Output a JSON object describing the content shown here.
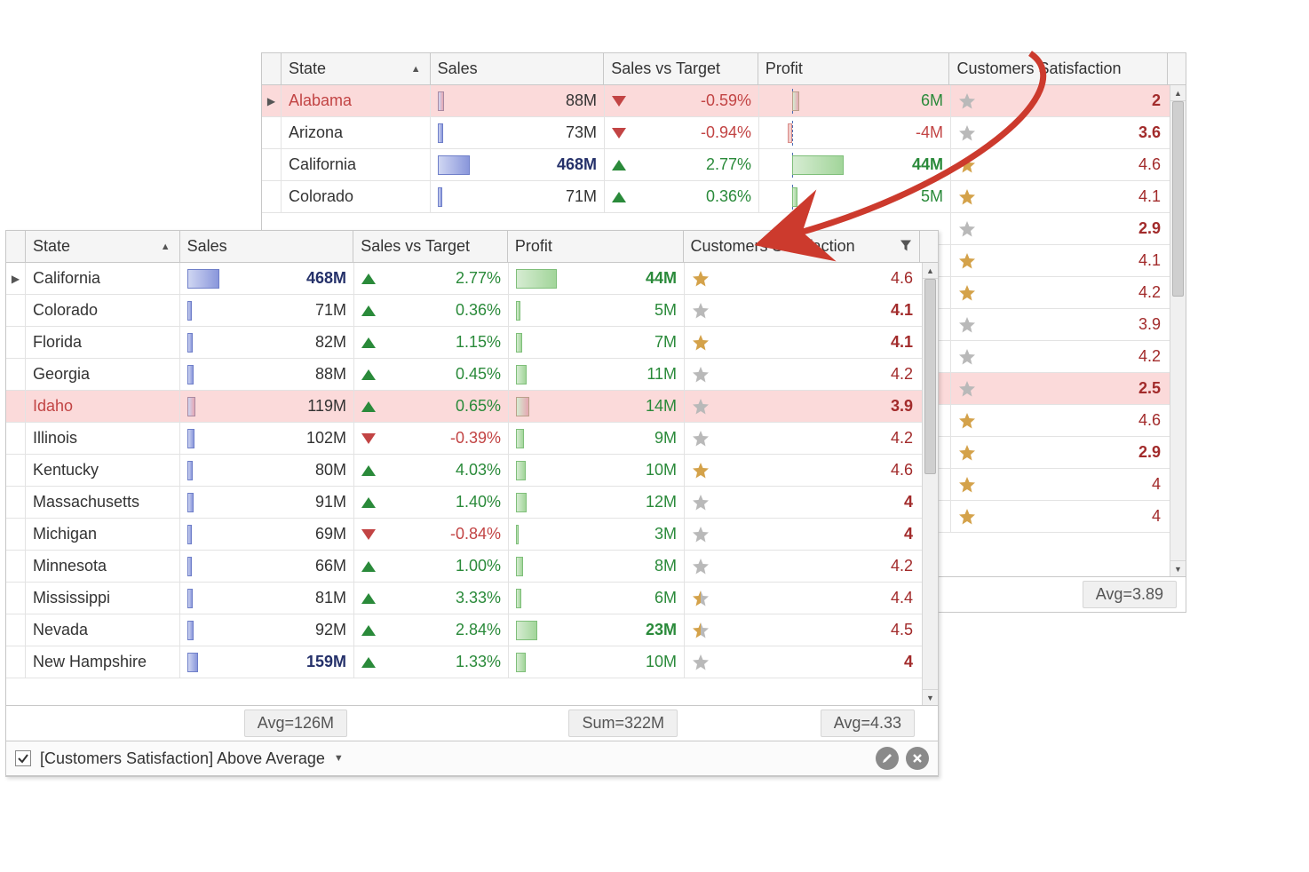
{
  "columns": {
    "state": "State",
    "sales": "Sales",
    "svt": "Sales vs Target",
    "profit": "Profit",
    "sat": "Customers Satisfaction"
  },
  "back_grid": {
    "rows": [
      {
        "state": "Alabama",
        "sales": "88M",
        "sales_pct": 19,
        "svt": "-0.59%",
        "svt_dir": "down",
        "profit": "6M",
        "profit_pct": 14,
        "profit_sign": "pos",
        "sat": "2",
        "sat_star": "grey",
        "sat_bold": true,
        "highlight": true,
        "current": true
      },
      {
        "state": "Arizona",
        "sales": "73M",
        "sales_pct": 16,
        "svt": "-0.94%",
        "svt_dir": "down",
        "profit": "-4M",
        "profit_pct": -9,
        "profit_sign": "neg",
        "sat": "3.6",
        "sat_star": "grey",
        "sat_bold": true
      },
      {
        "state": "California",
        "sales": "468M",
        "sales_pct": 100,
        "svt": "2.77%",
        "svt_dir": "up",
        "profit": "44M",
        "profit_pct": 100,
        "profit_sign": "pos",
        "profit_bold": true,
        "sales_bold": true,
        "sat": "4.6",
        "sat_star": "gold"
      },
      {
        "state": "Colorado",
        "sales": "71M",
        "sales_pct": 15,
        "svt": "0.36%",
        "svt_dir": "up",
        "profit": "5M",
        "profit_pct": 11,
        "profit_sign": "pos",
        "sat": "4.1",
        "sat_star": "gold"
      }
    ],
    "side_rows": [
      {
        "sat": "2.9",
        "sat_star": "grey",
        "sat_bold": true
      },
      {
        "sat": "4.1",
        "sat_star": "gold"
      },
      {
        "sat": "4.2",
        "sat_star": "gold"
      },
      {
        "sat": "3.9",
        "sat_star": "grey"
      },
      {
        "sat": "4.2",
        "sat_star": "grey"
      },
      {
        "sat": "2.5",
        "sat_star": "grey",
        "sat_bold": true,
        "highlight": true
      },
      {
        "sat": "4.6",
        "sat_star": "gold"
      },
      {
        "sat": "2.9",
        "sat_star": "gold",
        "sat_bold": true
      },
      {
        "sat": "4",
        "sat_star": "gold"
      },
      {
        "sat": "4",
        "sat_star": "gold"
      }
    ],
    "summary": {
      "sat": "Avg=3.89"
    }
  },
  "front_grid": {
    "rows": [
      {
        "state": "California",
        "sales": "468M",
        "sales_pct": 100,
        "sales_bold": true,
        "svt": "2.77%",
        "svt_dir": "up",
        "profit": "44M",
        "profit_pct": 100,
        "profit_bold": true,
        "sat": "4.6",
        "sat_star": "gold",
        "current": true
      },
      {
        "state": "Colorado",
        "sales": "71M",
        "sales_pct": 15,
        "svt": "0.36%",
        "svt_dir": "up",
        "profit": "5M",
        "profit_pct": 11,
        "sat": "4.1",
        "sat_star": "grey",
        "sat_bold": true
      },
      {
        "state": "Florida",
        "sales": "82M",
        "sales_pct": 18,
        "svt": "1.15%",
        "svt_dir": "up",
        "profit": "7M",
        "profit_pct": 16,
        "sat": "4.1",
        "sat_star": "gold",
        "sat_bold": true
      },
      {
        "state": "Georgia",
        "sales": "88M",
        "sales_pct": 19,
        "svt": "0.45%",
        "svt_dir": "up",
        "profit": "11M",
        "profit_pct": 25,
        "sat": "4.2",
        "sat_star": "grey"
      },
      {
        "state": "Idaho",
        "sales": "119M",
        "sales_pct": 25,
        "svt": "0.65%",
        "svt_dir": "up",
        "profit": "14M",
        "profit_pct": 32,
        "sat": "3.9",
        "sat_star": "grey",
        "sat_bold": true,
        "highlight": true
      },
      {
        "state": "Illinois",
        "sales": "102M",
        "sales_pct": 22,
        "svt": "-0.39%",
        "svt_dir": "down",
        "profit": "9M",
        "profit_pct": 20,
        "sat": "4.2",
        "sat_star": "grey"
      },
      {
        "state": "Kentucky",
        "sales": "80M",
        "sales_pct": 17,
        "svt": "4.03%",
        "svt_dir": "up",
        "profit": "10M",
        "profit_pct": 23,
        "sat": "4.6",
        "sat_star": "gold"
      },
      {
        "state": "Massachusetts",
        "sales": "91M",
        "sales_pct": 19,
        "svt": "1.40%",
        "svt_dir": "up",
        "profit": "12M",
        "profit_pct": 27,
        "sat": "4",
        "sat_star": "grey",
        "sat_bold": true
      },
      {
        "state": "Michigan",
        "sales": "69M",
        "sales_pct": 15,
        "svt": "-0.84%",
        "svt_dir": "down",
        "profit": "3M",
        "profit_pct": 7,
        "sat": "4",
        "sat_star": "grey",
        "sat_bold": true
      },
      {
        "state": "Minnesota",
        "sales": "66M",
        "sales_pct": 14,
        "svt": "1.00%",
        "svt_dir": "up",
        "profit": "8M",
        "profit_pct": 18,
        "sat": "4.2",
        "sat_star": "grey"
      },
      {
        "state": "Mississippi",
        "sales": "81M",
        "sales_pct": 17,
        "svt": "3.33%",
        "svt_dir": "up",
        "profit": "6M",
        "profit_pct": 14,
        "sat": "4.4",
        "sat_star": "half"
      },
      {
        "state": "Nevada",
        "sales": "92M",
        "sales_pct": 20,
        "svt": "2.84%",
        "svt_dir": "up",
        "profit": "23M",
        "profit_pct": 52,
        "profit_bold": true,
        "sat": "4.5",
        "sat_star": "half"
      },
      {
        "state": "New Hampshire",
        "sales": "159M",
        "sales_pct": 34,
        "sales_bold": true,
        "svt": "1.33%",
        "svt_dir": "up",
        "profit": "10M",
        "profit_pct": 23,
        "sat": "4",
        "sat_star": "grey",
        "sat_bold": true
      }
    ],
    "summary": {
      "sales": "Avg=126M",
      "profit": "Sum=322M",
      "sat": "Avg=4.33"
    },
    "filter": {
      "label": "[Customers Satisfaction] Above Average",
      "checked": true
    }
  },
  "chart_data": {
    "type": "table",
    "note": "Two data-grid views of a state sales table. The back grid shows all states; the front grid is filtered by 'Customers Satisfaction Above Average'. Sales and Profit columns render inline bar sparklines proportional to value; Sales vs Target shows a red/green trend arrow. Customers Satisfaction shows a star icon plus numeric score.",
    "back_grid_rows": [
      {
        "State": "Alabama",
        "Sales_M": 88,
        "SalesVsTarget_pct": -0.59,
        "Profit_M": 6,
        "CustomersSatisfaction": 2.0
      },
      {
        "State": "Arizona",
        "Sales_M": 73,
        "SalesVsTarget_pct": -0.94,
        "Profit_M": -4,
        "CustomersSatisfaction": 3.6
      },
      {
        "State": "California",
        "Sales_M": 468,
        "SalesVsTarget_pct": 2.77,
        "Profit_M": 44,
        "CustomersSatisfaction": 4.6
      },
      {
        "State": "Colorado",
        "Sales_M": 71,
        "SalesVsTarget_pct": 0.36,
        "Profit_M": 5,
        "CustomersSatisfaction": 4.1
      }
    ],
    "back_grid_extra_satisfaction_visible": [
      2.9,
      4.1,
      4.2,
      3.9,
      4.2,
      2.5,
      4.6,
      2.9,
      4.0,
      4.0
    ],
    "back_grid_summary": {
      "CustomersSatisfaction_avg": 3.89
    },
    "front_grid_rows": [
      {
        "State": "California",
        "Sales_M": 468,
        "SalesVsTarget_pct": 2.77,
        "Profit_M": 44,
        "CustomersSatisfaction": 4.6
      },
      {
        "State": "Colorado",
        "Sales_M": 71,
        "SalesVsTarget_pct": 0.36,
        "Profit_M": 5,
        "CustomersSatisfaction": 4.1
      },
      {
        "State": "Florida",
        "Sales_M": 82,
        "SalesVsTarget_pct": 1.15,
        "Profit_M": 7,
        "CustomersSatisfaction": 4.1
      },
      {
        "State": "Georgia",
        "Sales_M": 88,
        "SalesVsTarget_pct": 0.45,
        "Profit_M": 11,
        "CustomersSatisfaction": 4.2
      },
      {
        "State": "Idaho",
        "Sales_M": 119,
        "SalesVsTarget_pct": 0.65,
        "Profit_M": 14,
        "CustomersSatisfaction": 3.9
      },
      {
        "State": "Illinois",
        "Sales_M": 102,
        "SalesVsTarget_pct": -0.39,
        "Profit_M": 9,
        "CustomersSatisfaction": 4.2
      },
      {
        "State": "Kentucky",
        "Sales_M": 80,
        "SalesVsTarget_pct": 4.03,
        "Profit_M": 10,
        "CustomersSatisfaction": 4.6
      },
      {
        "State": "Massachusetts",
        "Sales_M": 91,
        "SalesVsTarget_pct": 1.4,
        "Profit_M": 12,
        "CustomersSatisfaction": 4.0
      },
      {
        "State": "Michigan",
        "Sales_M": 69,
        "SalesVsTarget_pct": -0.84,
        "Profit_M": 3,
        "CustomersSatisfaction": 4.0
      },
      {
        "State": "Minnesota",
        "Sales_M": 66,
        "SalesVsTarget_pct": 1.0,
        "Profit_M": 8,
        "CustomersSatisfaction": 4.2
      },
      {
        "State": "Mississippi",
        "Sales_M": 81,
        "SalesVsTarget_pct": 3.33,
        "Profit_M": 6,
        "CustomersSatisfaction": 4.4
      },
      {
        "State": "Nevada",
        "Sales_M": 92,
        "SalesVsTarget_pct": 2.84,
        "Profit_M": 23,
        "CustomersSatisfaction": 4.5
      },
      {
        "State": "New Hampshire",
        "Sales_M": 159,
        "SalesVsTarget_pct": 1.33,
        "Profit_M": 10,
        "CustomersSatisfaction": 4.0
      }
    ],
    "front_grid_summary": {
      "Sales_avg_M": 126,
      "Profit_sum_M": 322,
      "CustomersSatisfaction_avg": 4.33
    },
    "front_grid_filter": "[Customers Satisfaction] Above Average",
    "annotation_arrow": "A red curved arrow points from the Customers Satisfaction column header in the back grid down to the filtered front grid header, illustrating the effect of applying the filter."
  }
}
